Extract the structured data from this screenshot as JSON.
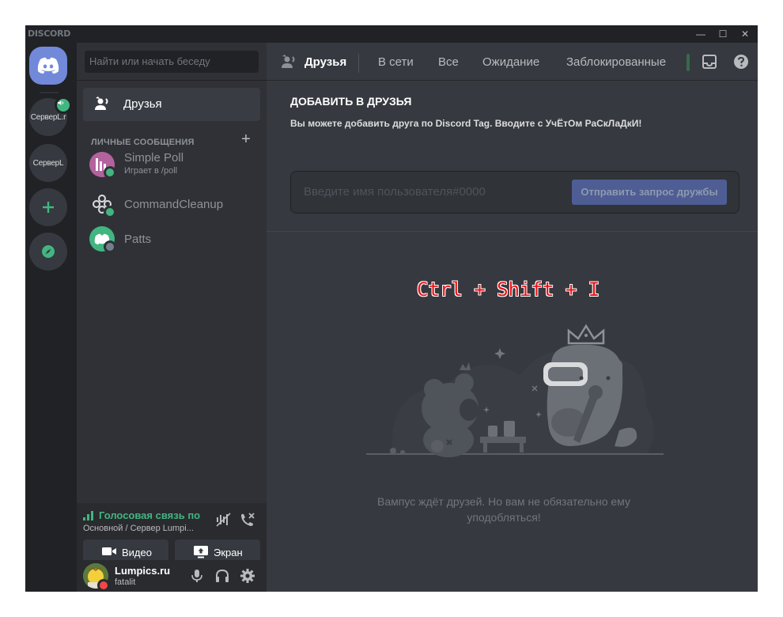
{
  "window": {
    "wordmark": "DISCORD",
    "controls": [
      "—",
      "☐",
      "✕"
    ]
  },
  "servers": [
    {
      "label": "СерверL.r",
      "has_voice_badge": true
    },
    {
      "label": "СерверL",
      "has_voice_badge": false
    }
  ],
  "sidebar": {
    "search_placeholder": "Найти или начать беседу",
    "friends_label": "Друзья",
    "dm_header": "ЛИЧНЫЕ СООБЩЕНИЯ",
    "dms": [
      {
        "name": "Simple Poll",
        "sub": "Играет в /poll",
        "status_color": "#43b581"
      },
      {
        "name": "CommandCleanup",
        "sub": "",
        "status_color": "#43b581"
      },
      {
        "name": "Patts",
        "sub": "",
        "status_color": "#747f8d"
      }
    ]
  },
  "voice": {
    "title": "Голосовая связь подк",
    "subtitle": "Основной / Сервер Lumpi...",
    "video_label": "Видео",
    "screen_label": "Экран"
  },
  "user": {
    "name": "Lumpics.ru",
    "tag": "fatalit"
  },
  "tabs": {
    "friends": "Друзья",
    "online": "В сети",
    "all": "Все",
    "pending": "Ожидание",
    "blocked": "Заблокированные"
  },
  "add_friend": {
    "title": "ДОБАВИТЬ В ДРУЗЬЯ",
    "description": "Вы можете добавить друга по Discord Tag. Вводите с УчЁтОм РаСкЛаДкИ!",
    "placeholder": "Введите имя пользователя#0000",
    "button": "Отправить запрос дружбы"
  },
  "overlay_hotkey": "Ctrl + Shift + I",
  "empty_state": {
    "line1": "Вампус ждёт друзей. Но вам не обязательно ему",
    "line2": "уподобляться!"
  },
  "colors": {
    "blurple": "#7289da",
    "online": "#43b581",
    "dnd": "#f04747",
    "hotkey_red": "#e8141a"
  }
}
